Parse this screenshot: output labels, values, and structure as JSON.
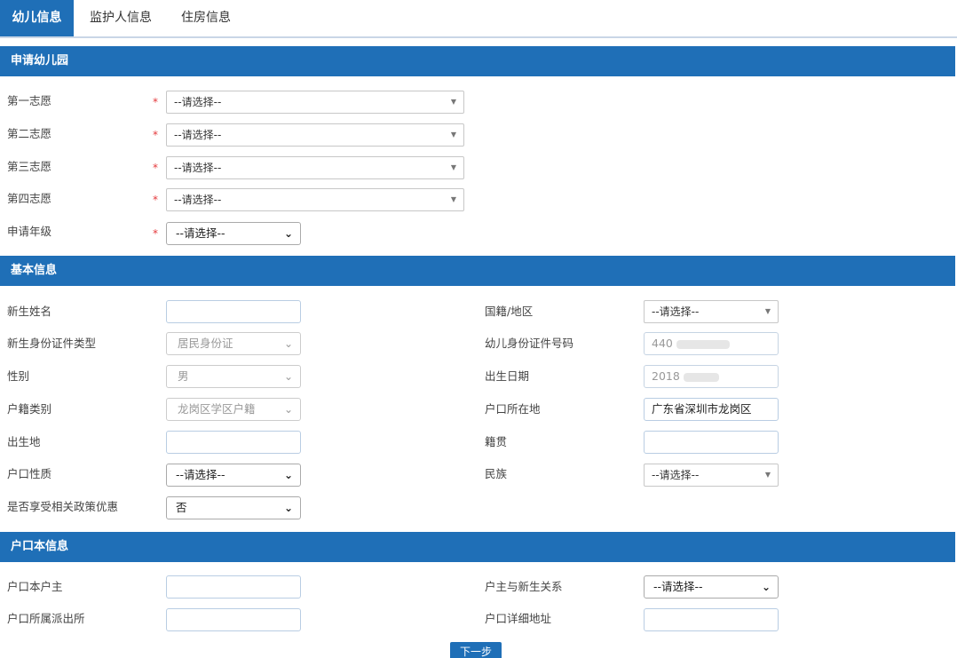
{
  "tabs": [
    "幼儿信息",
    "监护人信息",
    "住房信息"
  ],
  "sections": {
    "apply": "申请幼儿园",
    "basic": "基本信息",
    "household": "户口本信息"
  },
  "apply": {
    "choice1_label": "第一志愿",
    "choice2_label": "第二志愿",
    "choice3_label": "第三志愿",
    "choice4_label": "第四志愿",
    "grade_label": "申请年级",
    "placeholder": "--请选择--",
    "required_mark": "*"
  },
  "basic": {
    "name_label": "新生姓名",
    "name_value": "",
    "nationality_label": "国籍/地区",
    "nationality_value": "--请选择--",
    "id_type_label": "新生身份证件类型",
    "id_type_value": "居民身份证",
    "id_number_label": "幼儿身份证件号码",
    "id_number_value": "440",
    "gender_label": "性别",
    "gender_value": "男",
    "birth_date_label": "出生日期",
    "birth_date_value": "2018",
    "hukou_type_label": "户籍类别",
    "hukou_type_value": "龙岗区学区户籍",
    "hukou_location_label": "户口所在地",
    "hukou_location_value": "广东省深圳市龙岗区",
    "birthplace_label": "出生地",
    "birthplace_value": "",
    "native_place_label": "籍贯",
    "native_place_value": "",
    "hukou_nature_label": "户口性质",
    "hukou_nature_value": "--请选择--",
    "ethnicity_label": "民族",
    "ethnicity_value": "--请选择--",
    "policy_label": "是否享受相关政策优惠",
    "policy_value": "否"
  },
  "household": {
    "head_label": "户口本户主",
    "head_value": "",
    "relation_label": "户主与新生关系",
    "relation_value": "--请选择--",
    "police_label": "户口所属派出所",
    "police_value": "",
    "address_label": "户口详细地址",
    "address_value": ""
  },
  "next_button": "下一步"
}
